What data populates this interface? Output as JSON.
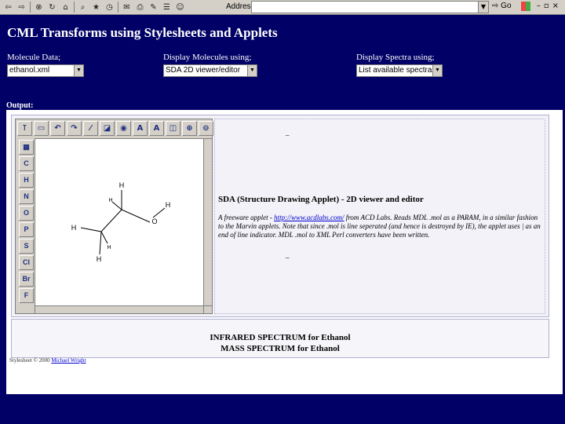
{
  "browser": {
    "address_label": "Address",
    "address_value": "",
    "go_label": "Go"
  },
  "page": {
    "title": "CML Transforms using Stylesheets and Applets"
  },
  "controls": {
    "molecule_label": "Molecule Data;",
    "molecule_value": "ethanol.xml",
    "display_label": "Display Molecules using;",
    "display_value": "SDA 2D viewer/editor",
    "spectra_label": "Display Spectra using;",
    "spectra_value": "List available spectra"
  },
  "output": {
    "label": "Output:",
    "elements": [
      "C",
      "H",
      "N",
      "O",
      "P",
      "S",
      "Cl",
      "Br",
      "F"
    ],
    "atoms": [
      "H",
      "H",
      "O",
      "H",
      "H",
      "H",
      "H"
    ],
    "sda_heading": "SDA (Structure Drawing Applet) - 2D viewer and editor",
    "sda_desc_prefix": "A freeware applet - ",
    "sda_link": "http://www.acdlabs.com/",
    "sda_desc_suffix": " from ACD Labs. Reads MDL .mol as a PARAM, in a similar fashion to the Marvin applets. Note that since .mol is line seperated (and hence is destroyed by IE), the applet uses | as an end of line indicator. MDL .mol to XML Perl converters have been written.",
    "dash": "_",
    "ir_spectrum": "INFRARED SPECTRUM for Ethanol",
    "mass_spectrum": "MASS SPECTRUM for Ethanol",
    "footer_text": "Stylesheet © 2000 ",
    "footer_author": "Michael Wright"
  }
}
